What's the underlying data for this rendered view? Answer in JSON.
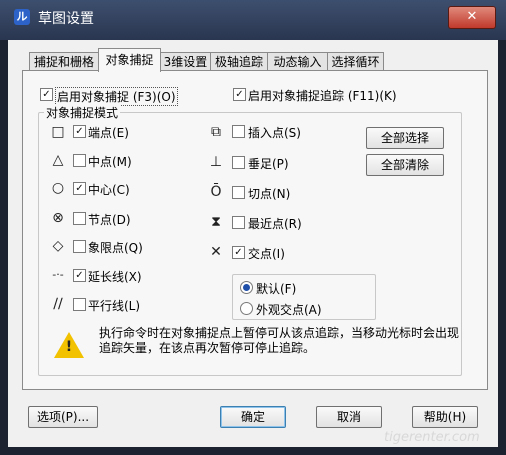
{
  "window": {
    "title": "草图设置",
    "close_symbol": "✕",
    "app_icon_letter": "ル"
  },
  "tabs": [
    {
      "label": "捕捉和栅格",
      "active": false
    },
    {
      "label": "对象捕捉",
      "active": true
    },
    {
      "label": "3维设置",
      "active": false
    },
    {
      "label": "极轴追踪",
      "active": false
    },
    {
      "label": "动态输入",
      "active": false
    },
    {
      "label": "选择循环",
      "active": false
    }
  ],
  "top_options": {
    "enable_osnap": {
      "label": "启用对象捕捉 (F3)(O)",
      "checked": true
    },
    "enable_tracking": {
      "label": "启用对象捕捉追踪 (F11)(K)",
      "checked": true
    }
  },
  "group_title": "对象捕捉模式",
  "snap_modes": [
    {
      "label": "端点(E)",
      "checked": true,
      "icon": "square-icon",
      "symbol": "□"
    },
    {
      "label": "中点(M)",
      "checked": false,
      "icon": "triangle-icon",
      "symbol": "△"
    },
    {
      "label": "中心(C)",
      "checked": true,
      "icon": "circle-icon",
      "symbol": "○"
    },
    {
      "label": "节点(D)",
      "checked": false,
      "icon": "node-icon",
      "symbol": "⊗"
    },
    {
      "label": "象限点(Q)",
      "checked": false,
      "icon": "diamond-icon",
      "symbol": "◇"
    },
    {
      "label": "延长线(X)",
      "checked": true,
      "icon": "extension-icon",
      "symbol": "-·-"
    },
    {
      "label": "平行线(L)",
      "checked": false,
      "icon": "parallel-icon",
      "symbol": "∕∕"
    },
    {
      "label": "插入点(S)",
      "checked": false,
      "icon": "insert-icon",
      "symbol": "⧉"
    },
    {
      "label": "垂足(P)",
      "checked": false,
      "icon": "perpendicular-icon",
      "symbol": "⊥"
    },
    {
      "label": "切点(N)",
      "checked": false,
      "icon": "tangent-icon",
      "symbol": "Ō"
    },
    {
      "label": "最近点(R)",
      "checked": false,
      "icon": "nearest-icon",
      "symbol": "⧗"
    },
    {
      "label": "交点(I)",
      "checked": true,
      "icon": "intersection-icon",
      "symbol": "✕"
    }
  ],
  "buttons": {
    "select_all": "全部选择",
    "clear_all": "全部清除",
    "options": "选项(P)...",
    "ok": "确定",
    "cancel": "取消",
    "help": "帮助(H)"
  },
  "radio_options": [
    {
      "label": "默认(F)",
      "selected": true
    },
    {
      "label": "外观交点(A)",
      "selected": false
    }
  ],
  "notice": "执行命令时在对象捕捉点上暂停可从该点追踪，当移动光标时会出现追踪矢量，在该点再次暂停可停止追踪。",
  "check_mark": "✓",
  "warning_mark": "!",
  "watermark": "tigerenter.com"
}
